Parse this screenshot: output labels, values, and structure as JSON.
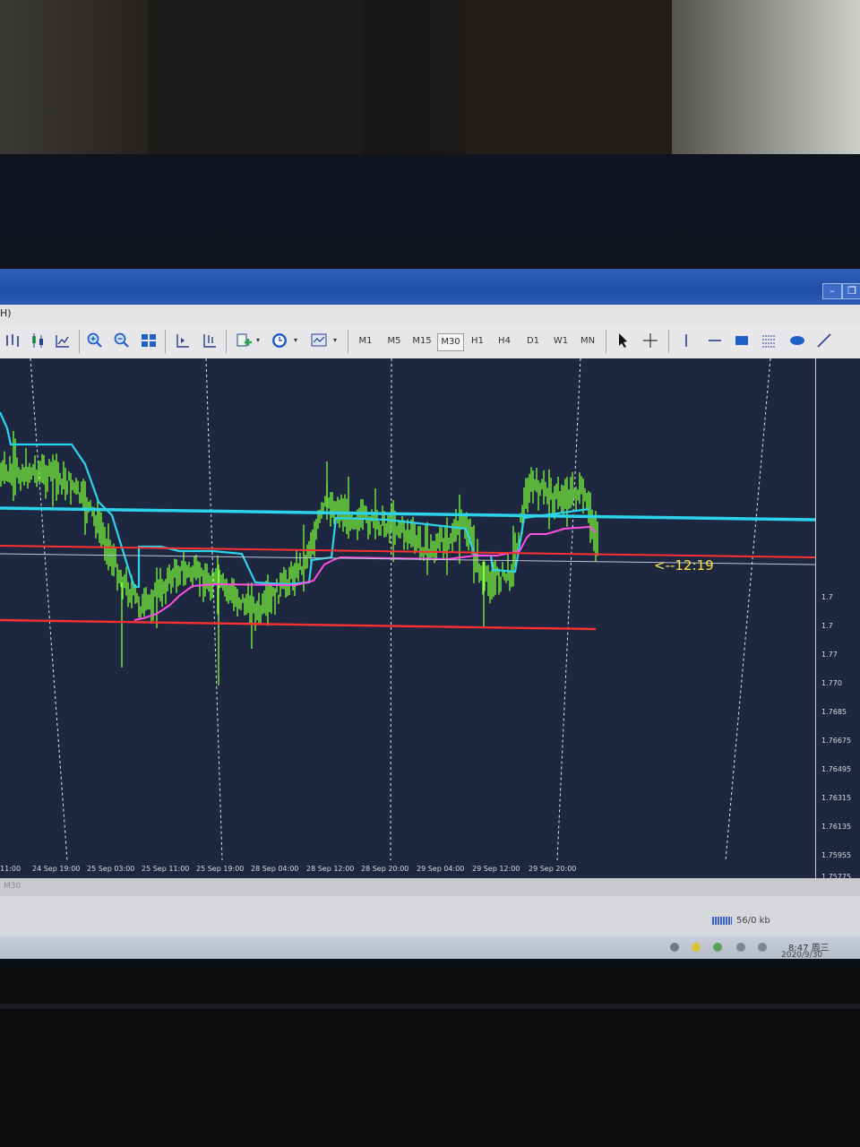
{
  "window": {
    "menu_fragment": "H)"
  },
  "toolbar": {
    "timeframes": [
      "M1",
      "M5",
      "M15",
      "M30",
      "H1",
      "H4",
      "D1",
      "W1",
      "MN"
    ],
    "active_timeframe": "M30"
  },
  "chart": {
    "price_labels": [
      "1.7",
      "1.7",
      "1.77",
      "1.770",
      "1.7685",
      "1.76675",
      "1.76495",
      "1.76315",
      "1.76135",
      "1.75955",
      "1.75775"
    ],
    "time_labels": [
      "11:00",
      "24 Sep 19:00",
      "25 Sep 03:00",
      "25 Sep 11:00",
      "25 Sep 19:00",
      "28 Sep 04:00",
      "28 Sep 12:00",
      "28 Sep 20:00",
      "29 Sep 04:00",
      "29 Sep 12:00",
      "29 Sep 20:00"
    ],
    "annotation": "<--12:19",
    "colors": {
      "background": "#1e2740",
      "bars": "#7cff3a",
      "cyan_line": "#2bd4ea",
      "magenta_line": "#ff4fe0",
      "red_line": "#ff3030",
      "annotation": "#ffe640"
    }
  },
  "tabs": {
    "fragment": "M30"
  },
  "status": {
    "traffic": "56/0 kb"
  },
  "taskbar": {
    "time": "8:47 周三",
    "date": "2020/9/30"
  }
}
